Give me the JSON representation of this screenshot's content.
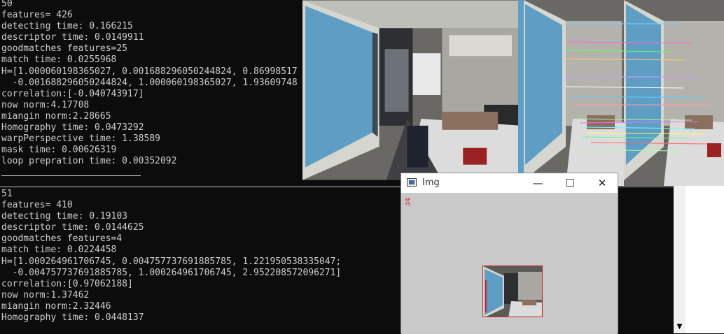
{
  "console": {
    "block1": [
      "50",
      "features= 426",
      "detecting time: 0.166215",
      "descriptor time: 0.0149911",
      "goodmatches features=25",
      "match time: 0.0255968",
      "H=[1.000060198365027, 0.001688296050244824, 0.86998517",
      "  -0.001688296050244824, 1.000060198365027, 1.93609748",
      "correlation:[-0.040743917]",
      "now norm:4.17708",
      "miangin norm:2.28665",
      "Homography time: 0.0473292",
      "warpPerspective time: 1.38589",
      "mask time: 0.00626319",
      "loop prepration time: 0.00352092"
    ],
    "block2": [
      "51",
      "features= 410",
      "detecting time: 0.19103",
      "descriptor time: 0.0144625",
      "goodmatches features=4",
      "match time: 0.0224458",
      "H=[1.000264961706745, 0.004757737691885785, 1.221950538335047;",
      "  -0.004757737691885785, 1.000264961706745, 2.952208572096271]",
      "correlation:[0.97062188]",
      "now norm:1.37462",
      "miangin norm:2.32446",
      "Homography time: 0.0448137"
    ]
  },
  "img_window": {
    "title": "Img",
    "minimize_glyph": "—",
    "maximize_glyph": "☐",
    "close_glyph": "✕",
    "red_label_lines": [
      "NF",
      "FS"
    ]
  },
  "scrollbar": {
    "down_arrow_glyph": "▼"
  },
  "colors": {
    "console_bg": "#0c0c0c",
    "console_fg": "#cccccc",
    "match_line": "#7fd0ff",
    "marker_red": "#d02020"
  }
}
